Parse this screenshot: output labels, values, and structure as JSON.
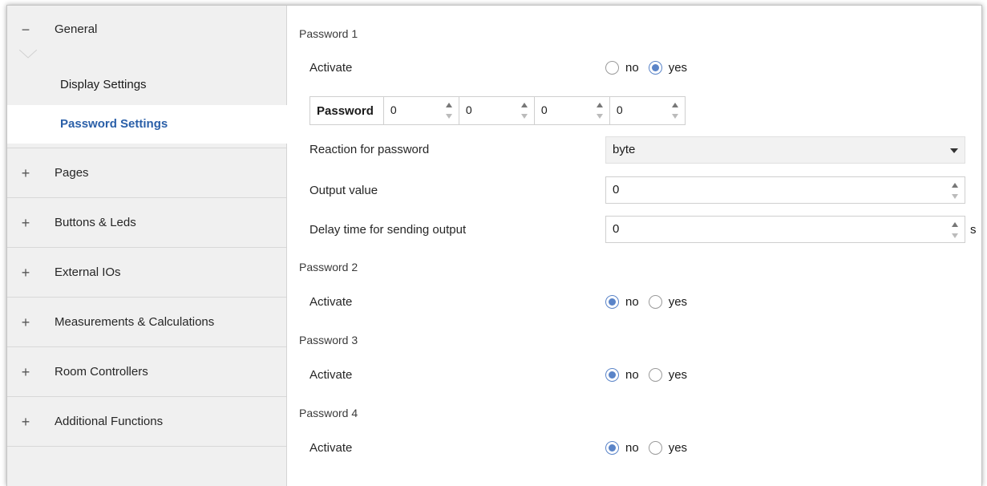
{
  "sidebar": {
    "general": {
      "sign": "−",
      "label": "General"
    },
    "sub_items": [
      {
        "label": "Display Settings"
      },
      {
        "label": "Password Settings"
      }
    ],
    "items": [
      {
        "sign": "+",
        "label": "Pages"
      },
      {
        "sign": "+",
        "label": "Buttons & Leds"
      },
      {
        "sign": "+",
        "label": "External IOs"
      },
      {
        "sign": "+",
        "label": "Measurements & Calculations"
      },
      {
        "sign": "+",
        "label": "Room Controllers"
      },
      {
        "sign": "+",
        "label": "Additional Functions"
      }
    ]
  },
  "main": {
    "password1": {
      "title": "Password 1",
      "activate_label": "Activate",
      "no_label": "no",
      "yes_label": "yes",
      "selected": "yes",
      "password_label": "Password",
      "digits": [
        "0",
        "0",
        "0",
        "0"
      ],
      "reaction_label": "Reaction for password",
      "reaction_value": "byte",
      "output_label": "Output value",
      "output_value": "0",
      "delay_label": "Delay time for sending output",
      "delay_value": "0",
      "delay_unit": "s"
    },
    "password2": {
      "title": "Password 2",
      "activate_label": "Activate",
      "no_label": "no",
      "yes_label": "yes",
      "selected": "no"
    },
    "password3": {
      "title": "Password 3",
      "activate_label": "Activate",
      "no_label": "no",
      "yes_label": "yes",
      "selected": "no"
    },
    "password4": {
      "title": "Password 4",
      "activate_label": "Activate",
      "no_label": "no",
      "yes_label": "yes",
      "selected": "no"
    }
  },
  "colors": {
    "accent": "#2a5fa8",
    "radio_selected": "#5a84c8",
    "sidebar_bg": "#f0f0f0"
  }
}
